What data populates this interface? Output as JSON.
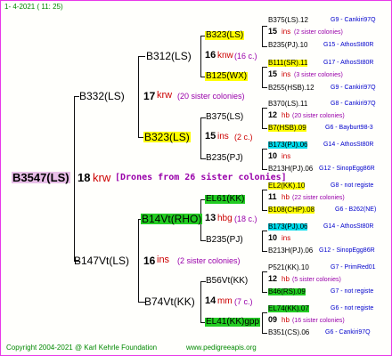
{
  "header": {
    "date_text": "1-  4-2021 ( 11: 25)"
  },
  "root": {
    "label": "B3547(LS)",
    "count": "18",
    "race": "krw",
    "note": "[Drones from 26 sister colonies]"
  },
  "gen1": [
    {
      "label": "B332(LS)",
      "count": "17",
      "race": "krw",
      "note": "(20 sister colonies)"
    },
    {
      "label": "B147Vt(LS)",
      "count": "16",
      "race": "ins",
      "note": "(2 sister colonies)"
    }
  ],
  "gen2": [
    {
      "label": "B312(LS)",
      "count": "16",
      "race": "knw",
      "note": "(16 c.)"
    },
    {
      "label": "B323(LS)",
      "count": "15",
      "race": "ins",
      "note": "(2 c.)"
    },
    {
      "label": "B14Vt(RHO)",
      "count": "13",
      "race": "hbg",
      "note": "(18 c.)"
    },
    {
      "label": "B74Vt(KK)",
      "count": "14",
      "race": "mm",
      "note": "(7 c.)"
    }
  ],
  "gen3": [
    {
      "label": "B323(LS)",
      "count": "15",
      "race": "ins",
      "note": "(2 sister colonies)"
    },
    {
      "label": "B125(WX)",
      "count": "15",
      "race": "ins",
      "note": "(3 sister colonies)"
    },
    {
      "label": "B375(LS)",
      "count": "12",
      "race": "hb",
      "note": "(20 sister colonies)"
    },
    {
      "label": "B235(PJ)",
      "count": "10",
      "race": "ins",
      "note": ""
    },
    {
      "label": "EL61(KK)",
      "count": "11",
      "race": "hb",
      "note": "(22 sister colonies)"
    },
    {
      "label": "B235(PJ)",
      "count": "10",
      "race": "ins",
      "note": ""
    },
    {
      "label": "B56Vt(KK)",
      "count": "12",
      "race": "hb",
      "note": "(5 sister colonies)"
    },
    {
      "label": "EL41(KK)gpp",
      "count": "09",
      "race": "hb",
      "note": "(16 sister colonies)"
    }
  ],
  "gen4": [
    {
      "label": "B375(LS).12",
      "g": "G9 - Cankiri97Q"
    },
    {
      "label": "B235(PJ).10",
      "g": "G15 - AthosSt80R"
    },
    {
      "label": "B111(SR).11",
      "g": "G17 - AthosSt80R"
    },
    {
      "label": "B255(HSB).12",
      "g": "G9 - Cankiri97Q"
    },
    {
      "label": "B370(LS).11",
      "g": "G8 - Cankiri97Q"
    },
    {
      "label": "B7(HSB).09",
      "g": "G6 - Bayburt98-3"
    },
    {
      "label": "B173(PJ).06",
      "g": "G14 - AthosSt80R"
    },
    {
      "label": "B213H(PJ).06",
      "g": "G12 - SinopEgg86R"
    },
    {
      "label": "EL2(KK).10",
      "g": "G8 - not registe"
    },
    {
      "label": "B108(CHP).08",
      "g": "G6 - B262(NE)"
    },
    {
      "label": "B173(PJ).06",
      "g": "G14 - AthosSt80R"
    },
    {
      "label": "B213H(PJ).06",
      "g": "G12 - SinopEgg86R"
    },
    {
      "label": "P521(KK).10",
      "g": "G7 - PrimRed01"
    },
    {
      "label": "B46(RS).09",
      "g": "G7 - not registe"
    },
    {
      "label": "EL74(KK).07",
      "g": "G6 - not registe"
    },
    {
      "label": "B351(CS).06",
      "g": "G6 - Cankiri97Q"
    }
  ],
  "footer": {
    "copyright": "Copyright 2004-2021 @ Karl Kehrle Foundation",
    "url": "www.pedigreeapis.org"
  },
  "colors": {
    "border": "#e838e8",
    "yellow": "#ffff00",
    "green": "#22cc22",
    "cyan": "#00ddee",
    "race": "#cc0000",
    "note": "#9900aa",
    "gcode": "#0000cc",
    "footer": "#008800"
  }
}
